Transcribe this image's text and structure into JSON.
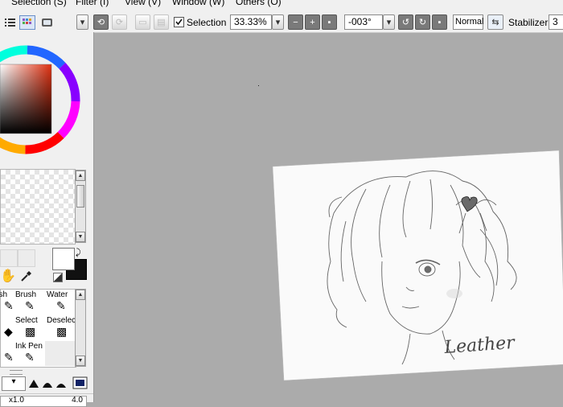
{
  "menubar": {
    "items": [
      "Selection (S)",
      "Filter (I)",
      "View (V)",
      "Window (W)",
      "Others (O)"
    ]
  },
  "toolbar": {
    "selection_label": "Selection",
    "selection_checked": true,
    "zoom_value": "33.33%",
    "rotation_value": "-003°",
    "blend_mode": "Normal",
    "stabilizer_label": "Stabilizer",
    "stabilizer_value": "3"
  },
  "side_panel": {
    "tools": [
      {
        "name": "ush",
        "icon": "brush-icon"
      },
      {
        "name": "Brush",
        "icon": "brush-icon"
      },
      {
        "name": "Water",
        "icon": "water-brush-icon"
      },
      {
        "name": "r",
        "icon": "eraser-icon"
      },
      {
        "name": "Select",
        "icon": "select-brush-icon"
      },
      {
        "name": "Deselect",
        "icon": "deselect-brush-icon"
      },
      {
        "name": "y",
        "icon": "pen-icon"
      },
      {
        "name": "Ink Pen",
        "icon": "ink-pen-icon"
      }
    ],
    "size_min": "x1.0",
    "size_value": "4.0",
    "primary_color": "#ffffff",
    "secondary_color": "#111111"
  },
  "artwork": {
    "signature": "Leather"
  }
}
